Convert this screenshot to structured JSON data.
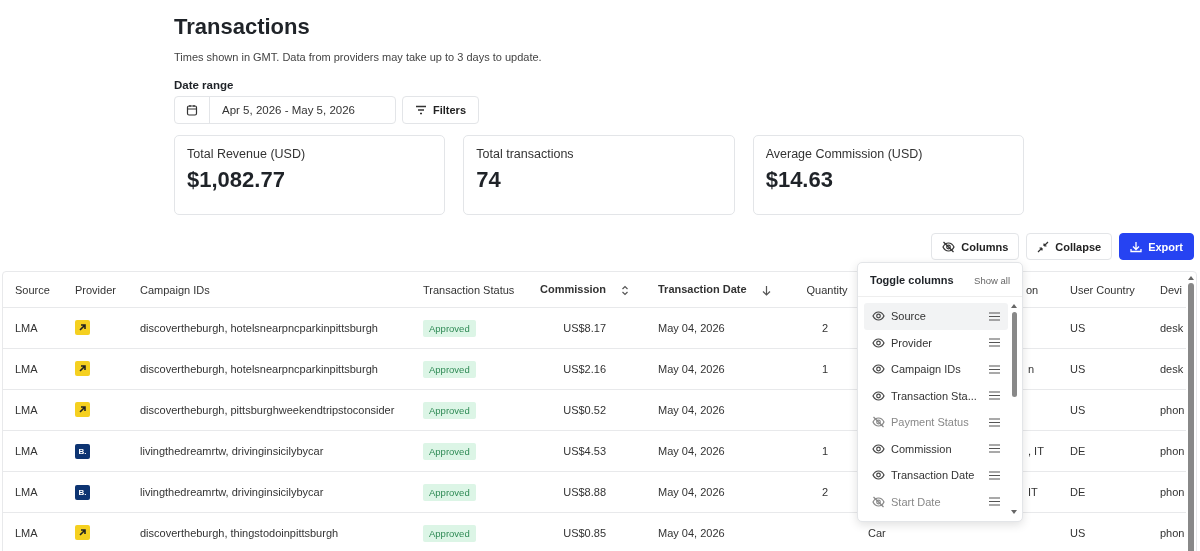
{
  "page": {
    "title": "Transactions",
    "subtitle": "Times shown in GMT. Data from providers may take up to 3 days to update."
  },
  "date_range": {
    "label": "Date range",
    "value": "Apr 5, 2026 - May 5, 2026"
  },
  "filters_button": "Filters",
  "stats": [
    {
      "label": "Total Revenue (USD)",
      "value": "$1,082.77"
    },
    {
      "label": "Total transactions",
      "value": "74"
    },
    {
      "label": "Average Commission (USD)",
      "value": "$14.63"
    }
  ],
  "toolbar": [
    {
      "kind": "columns",
      "label": "Columns"
    },
    {
      "kind": "collapse",
      "label": "Collapse"
    },
    {
      "kind": "export",
      "label": "Export"
    }
  ],
  "table": {
    "columns": [
      {
        "label": "Source",
        "sortable": false,
        "sorted": false
      },
      {
        "label": "Provider",
        "sortable": false,
        "sorted": false
      },
      {
        "label": "Campaign IDs",
        "sortable": false,
        "sorted": false
      },
      {
        "label": "Transaction Status",
        "sortable": false,
        "sorted": false
      },
      {
        "label": "Commission",
        "sortable": true,
        "sorted": false
      },
      {
        "label": "Transaction Date",
        "sortable": false,
        "sorted": true
      },
      {
        "label": "Quantity",
        "sortable": false,
        "sorted": false
      },
      {
        "label": "on",
        "sortable": false,
        "sorted": false
      },
      {
        "label": "User Country",
        "sortable": false,
        "sorted": false
      },
      {
        "label": "Devi",
        "sortable": false,
        "sorted": false
      }
    ],
    "rows": [
      {
        "source": "LMA",
        "provider": {
          "kind": "arrow"
        },
        "campaign": "discovertheburgh, hotelsnearpncparkinpittsburgh",
        "status": "Approved",
        "commission": "US$8.17",
        "date": "May 04, 2026",
        "quantity": "2",
        "user_country": "US",
        "device": "desk"
      },
      {
        "source": "LMA",
        "provider": {
          "kind": "arrow"
        },
        "campaign": "discovertheburgh, hotelsnearpncparkinpittsburgh",
        "status": "Approved",
        "commission": "US$2.16",
        "date": "May 04, 2026",
        "quantity": "1",
        "column_8": "n",
        "user_country": "US",
        "device": "desk"
      },
      {
        "source": "LMA",
        "provider": {
          "kind": "arrow"
        },
        "campaign": "discovertheburgh, pittsburghweekendtripstoconsider",
        "status": "Approved",
        "commission": "US$0.52",
        "date": "May 04, 2026",
        "user_country": "US",
        "device": "phon"
      },
      {
        "source": "LMA",
        "provider": {
          "kind": "letter",
          "text": "B."
        },
        "campaign": "livingthedreamrtw, drivinginsicilybycar",
        "status": "Approved",
        "commission": "US$4.53",
        "date": "May 04, 2026",
        "quantity": "1",
        "column_8": ", IT",
        "user_country": "DE",
        "device": "phon"
      },
      {
        "source": "LMA",
        "provider": {
          "kind": "letter",
          "text": "B."
        },
        "campaign": "livingthedreamrtw, drivinginsicilybycar",
        "status": "Approved",
        "commission": "US$8.88",
        "date": "May 04, 2026",
        "quantity": "2",
        "column_8": "IT",
        "user_country": "DE",
        "device": "phon"
      },
      {
        "source": "LMA",
        "provider": {
          "kind": "arrow"
        },
        "campaign": "discovertheburgh, thingstodoinpittsburgh",
        "status": "Approved",
        "commission": "US$0.85",
        "date": "May 04, 2026",
        "column_8": "Car",
        "user_country": "US",
        "device": "phon"
      }
    ]
  },
  "column_menu": {
    "title": "Toggle columns",
    "action": "Show all",
    "items": [
      {
        "label": "Source",
        "visible": true,
        "selected": true
      },
      {
        "label": "Provider",
        "visible": true,
        "selected": false
      },
      {
        "label": "Campaign IDs",
        "visible": true,
        "selected": false
      },
      {
        "label": "Transaction Sta...",
        "visible": true,
        "selected": false
      },
      {
        "label": "Payment Status",
        "visible": false,
        "selected": false
      },
      {
        "label": "Commission",
        "visible": true,
        "selected": false
      },
      {
        "label": "Transaction Date",
        "visible": true,
        "selected": false
      },
      {
        "label": "Start Date",
        "visible": false,
        "selected": false
      }
    ]
  }
}
